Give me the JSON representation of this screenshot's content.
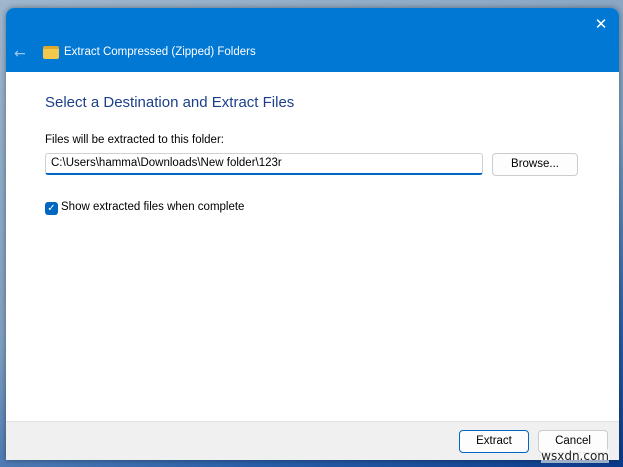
{
  "window": {
    "title": "Extract Compressed (Zipped) Folders",
    "close_icon": "close-icon",
    "back_icon": "arrow-left-icon"
  },
  "main": {
    "heading": "Select a Destination and Extract Files",
    "path_label": "Files will be extracted to this folder:",
    "path_value": "C:\\Users\\hamma\\Downloads\\New folder\\123r",
    "browse_label": "Browse...",
    "show_files_label": "Show extracted files when complete",
    "show_files_checked": true
  },
  "footer": {
    "extract_label": "Extract",
    "cancel_label": "Cancel"
  },
  "watermark": "wsxdn.com",
  "colors": {
    "accent": "#0078d4",
    "heading": "#1c3f8a"
  }
}
